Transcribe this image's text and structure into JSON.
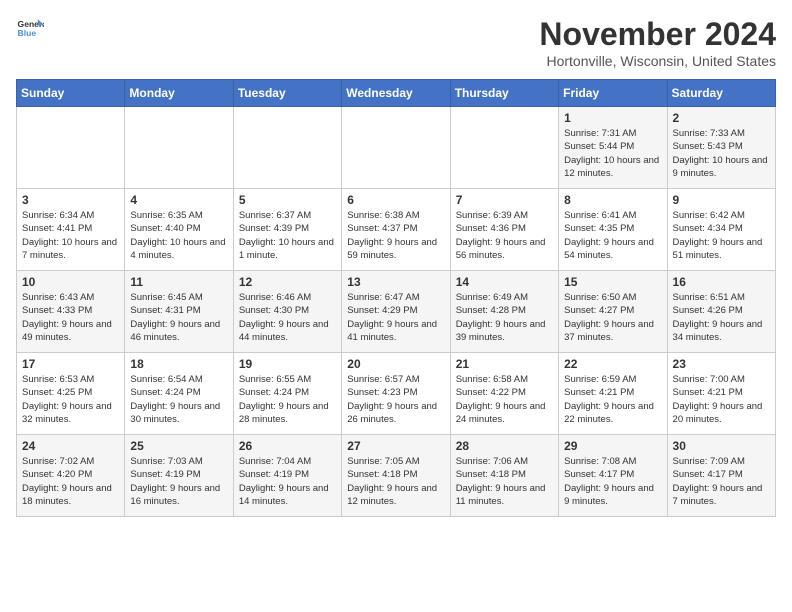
{
  "logo": {
    "line1": "General",
    "line2": "Blue"
  },
  "title": "November 2024",
  "location": "Hortonville, Wisconsin, United States",
  "weekdays": [
    "Sunday",
    "Monday",
    "Tuesday",
    "Wednesday",
    "Thursday",
    "Friday",
    "Saturday"
  ],
  "weeks": [
    [
      {
        "day": "",
        "info": ""
      },
      {
        "day": "",
        "info": ""
      },
      {
        "day": "",
        "info": ""
      },
      {
        "day": "",
        "info": ""
      },
      {
        "day": "",
        "info": ""
      },
      {
        "day": "1",
        "info": "Sunrise: 7:31 AM\nSunset: 5:44 PM\nDaylight: 10 hours and 12 minutes."
      },
      {
        "day": "2",
        "info": "Sunrise: 7:33 AM\nSunset: 5:43 PM\nDaylight: 10 hours and 9 minutes."
      }
    ],
    [
      {
        "day": "3",
        "info": "Sunrise: 6:34 AM\nSunset: 4:41 PM\nDaylight: 10 hours and 7 minutes."
      },
      {
        "day": "4",
        "info": "Sunrise: 6:35 AM\nSunset: 4:40 PM\nDaylight: 10 hours and 4 minutes."
      },
      {
        "day": "5",
        "info": "Sunrise: 6:37 AM\nSunset: 4:39 PM\nDaylight: 10 hours and 1 minute."
      },
      {
        "day": "6",
        "info": "Sunrise: 6:38 AM\nSunset: 4:37 PM\nDaylight: 9 hours and 59 minutes."
      },
      {
        "day": "7",
        "info": "Sunrise: 6:39 AM\nSunset: 4:36 PM\nDaylight: 9 hours and 56 minutes."
      },
      {
        "day": "8",
        "info": "Sunrise: 6:41 AM\nSunset: 4:35 PM\nDaylight: 9 hours and 54 minutes."
      },
      {
        "day": "9",
        "info": "Sunrise: 6:42 AM\nSunset: 4:34 PM\nDaylight: 9 hours and 51 minutes."
      }
    ],
    [
      {
        "day": "10",
        "info": "Sunrise: 6:43 AM\nSunset: 4:33 PM\nDaylight: 9 hours and 49 minutes."
      },
      {
        "day": "11",
        "info": "Sunrise: 6:45 AM\nSunset: 4:31 PM\nDaylight: 9 hours and 46 minutes."
      },
      {
        "day": "12",
        "info": "Sunrise: 6:46 AM\nSunset: 4:30 PM\nDaylight: 9 hours and 44 minutes."
      },
      {
        "day": "13",
        "info": "Sunrise: 6:47 AM\nSunset: 4:29 PM\nDaylight: 9 hours and 41 minutes."
      },
      {
        "day": "14",
        "info": "Sunrise: 6:49 AM\nSunset: 4:28 PM\nDaylight: 9 hours and 39 minutes."
      },
      {
        "day": "15",
        "info": "Sunrise: 6:50 AM\nSunset: 4:27 PM\nDaylight: 9 hours and 37 minutes."
      },
      {
        "day": "16",
        "info": "Sunrise: 6:51 AM\nSunset: 4:26 PM\nDaylight: 9 hours and 34 minutes."
      }
    ],
    [
      {
        "day": "17",
        "info": "Sunrise: 6:53 AM\nSunset: 4:25 PM\nDaylight: 9 hours and 32 minutes."
      },
      {
        "day": "18",
        "info": "Sunrise: 6:54 AM\nSunset: 4:24 PM\nDaylight: 9 hours and 30 minutes."
      },
      {
        "day": "19",
        "info": "Sunrise: 6:55 AM\nSunset: 4:24 PM\nDaylight: 9 hours and 28 minutes."
      },
      {
        "day": "20",
        "info": "Sunrise: 6:57 AM\nSunset: 4:23 PM\nDaylight: 9 hours and 26 minutes."
      },
      {
        "day": "21",
        "info": "Sunrise: 6:58 AM\nSunset: 4:22 PM\nDaylight: 9 hours and 24 minutes."
      },
      {
        "day": "22",
        "info": "Sunrise: 6:59 AM\nSunset: 4:21 PM\nDaylight: 9 hours and 22 minutes."
      },
      {
        "day": "23",
        "info": "Sunrise: 7:00 AM\nSunset: 4:21 PM\nDaylight: 9 hours and 20 minutes."
      }
    ],
    [
      {
        "day": "24",
        "info": "Sunrise: 7:02 AM\nSunset: 4:20 PM\nDaylight: 9 hours and 18 minutes."
      },
      {
        "day": "25",
        "info": "Sunrise: 7:03 AM\nSunset: 4:19 PM\nDaylight: 9 hours and 16 minutes."
      },
      {
        "day": "26",
        "info": "Sunrise: 7:04 AM\nSunset: 4:19 PM\nDaylight: 9 hours and 14 minutes."
      },
      {
        "day": "27",
        "info": "Sunrise: 7:05 AM\nSunset: 4:18 PM\nDaylight: 9 hours and 12 minutes."
      },
      {
        "day": "28",
        "info": "Sunrise: 7:06 AM\nSunset: 4:18 PM\nDaylight: 9 hours and 11 minutes."
      },
      {
        "day": "29",
        "info": "Sunrise: 7:08 AM\nSunset: 4:17 PM\nDaylight: 9 hours and 9 minutes."
      },
      {
        "day": "30",
        "info": "Sunrise: 7:09 AM\nSunset: 4:17 PM\nDaylight: 9 hours and 7 minutes."
      }
    ]
  ]
}
